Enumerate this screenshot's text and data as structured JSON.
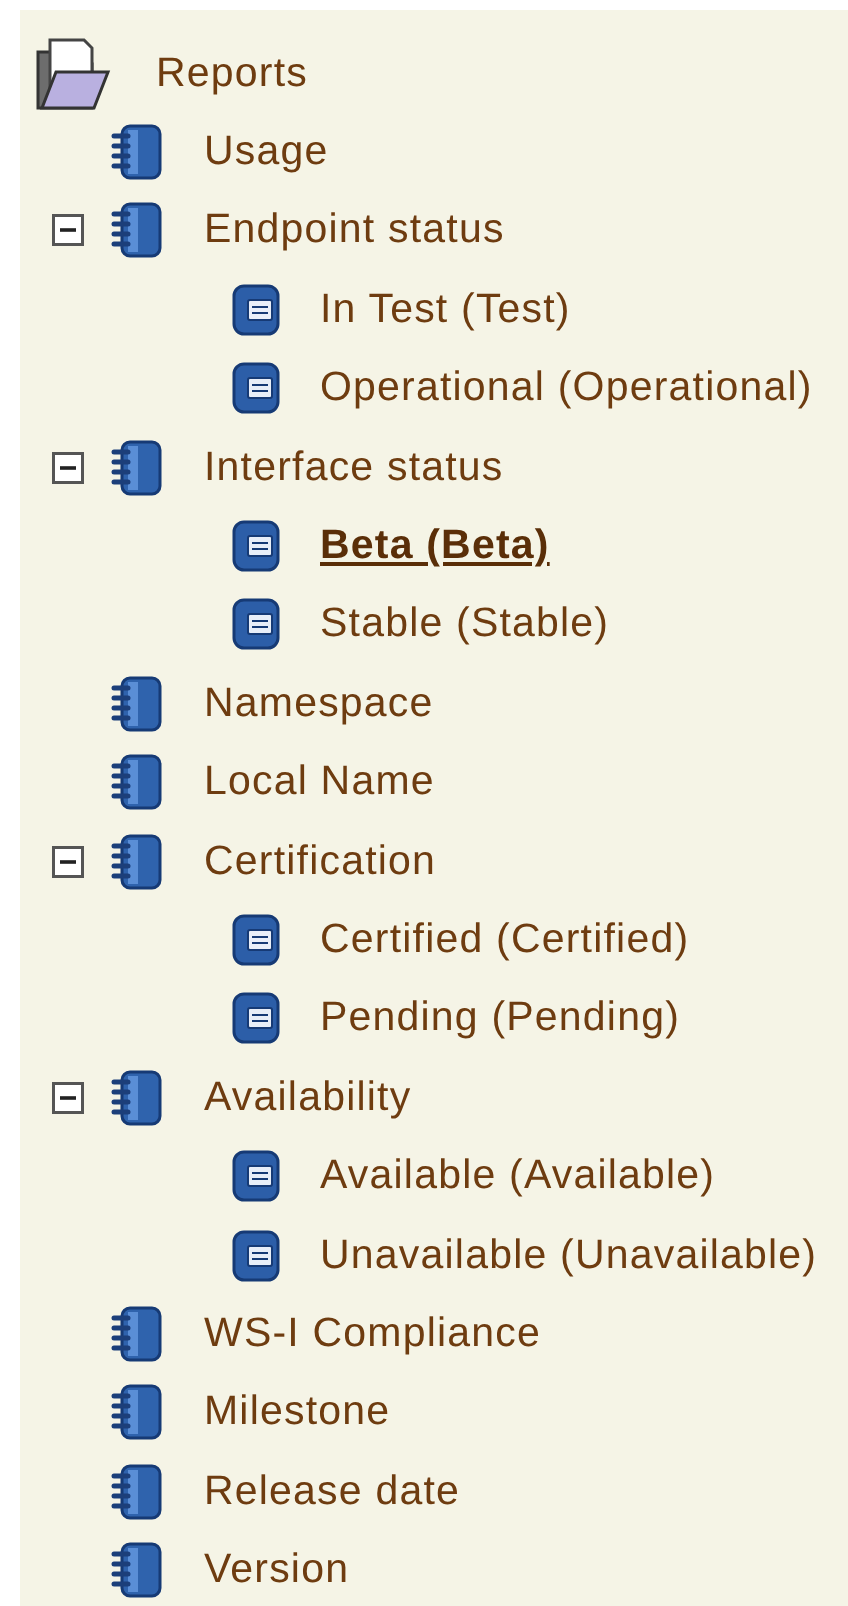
{
  "tree": {
    "label": "Reports",
    "selected": false,
    "children": [
      {
        "label": "Usage",
        "kind": "book",
        "selected": false
      },
      {
        "label": "Endpoint status",
        "kind": "book",
        "expanded": true,
        "selected": false,
        "children": [
          {
            "label": "In Test (Test)",
            "kind": "page",
            "selected": false
          },
          {
            "label": "Operational (Operational)",
            "kind": "page",
            "selected": false
          }
        ]
      },
      {
        "label": "Interface status",
        "kind": "book",
        "expanded": true,
        "selected": false,
        "children": [
          {
            "label": "Beta (Beta)",
            "kind": "page",
            "selected": true
          },
          {
            "label": "Stable (Stable)",
            "kind": "page",
            "selected": false
          }
        ]
      },
      {
        "label": "Namespace",
        "kind": "book",
        "selected": false
      },
      {
        "label": "Local Name",
        "kind": "book",
        "selected": false
      },
      {
        "label": "Certification",
        "kind": "book",
        "expanded": true,
        "selected": false,
        "children": [
          {
            "label": "Certified (Certified)",
            "kind": "page",
            "selected": false
          },
          {
            "label": "Pending (Pending)",
            "kind": "page",
            "selected": false
          }
        ]
      },
      {
        "label": "Availability",
        "kind": "book",
        "expanded": true,
        "selected": false,
        "children": [
          {
            "label": "Available (Available)",
            "kind": "page",
            "selected": false
          },
          {
            "label": "Unavailable (Unavailable)",
            "kind": "page",
            "selected": false
          }
        ]
      },
      {
        "label": "WS-I Compliance",
        "kind": "book",
        "selected": false
      },
      {
        "label": "Milestone",
        "kind": "book",
        "selected": false
      },
      {
        "label": "Release date",
        "kind": "book",
        "selected": false
      },
      {
        "label": "Version",
        "kind": "book",
        "selected": false
      }
    ]
  }
}
